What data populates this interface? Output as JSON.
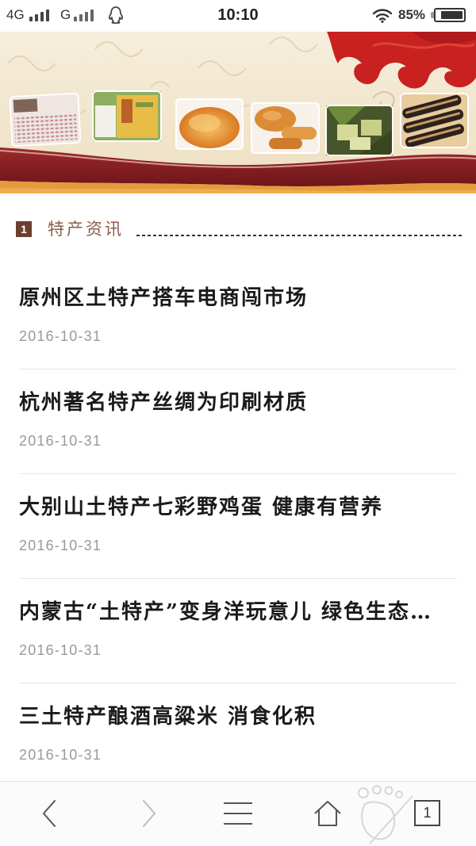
{
  "status_bar": {
    "network_primary": "4G",
    "network_secondary": "G",
    "time": "10:10",
    "battery_text": "85%",
    "battery_level": 0.85,
    "icons": [
      "signal-icon",
      "qq-icon",
      "wifi-icon",
      "battery-icon"
    ]
  },
  "section": {
    "index": "1",
    "title": "特产资讯"
  },
  "news": [
    {
      "title": "原州区土特产搭车电商闯市场",
      "date": "2016-10-31"
    },
    {
      "title": "杭州著名特产丝绸为印刷材质",
      "date": "2016-10-31"
    },
    {
      "title": "大别山土特产七彩野鸡蛋 健康有营养",
      "date": "2016-10-31"
    },
    {
      "title": "内蒙古“土特产”变身洋玩意儿 绿色生态…",
      "date": "2016-10-31"
    },
    {
      "title": "三土特产酿酒高粱米 消食化积",
      "date": "2016-10-31"
    }
  ],
  "bottom_nav": {
    "tab_count": "1",
    "icons": [
      "chevron-left-icon",
      "chevron-right-icon",
      "menu-icon",
      "home-icon",
      "footprint-watermark-icon",
      "tabs-icon"
    ]
  },
  "theme": {
    "accent": "#6b3f2f",
    "section_title": "#8b5e4a",
    "banner_red": "#c8211f",
    "banner_maroon": "#8a1f24",
    "banner_orange": "#e79a3b",
    "text": "#222222",
    "date": "#999999",
    "divider": "#e6e6e6"
  }
}
